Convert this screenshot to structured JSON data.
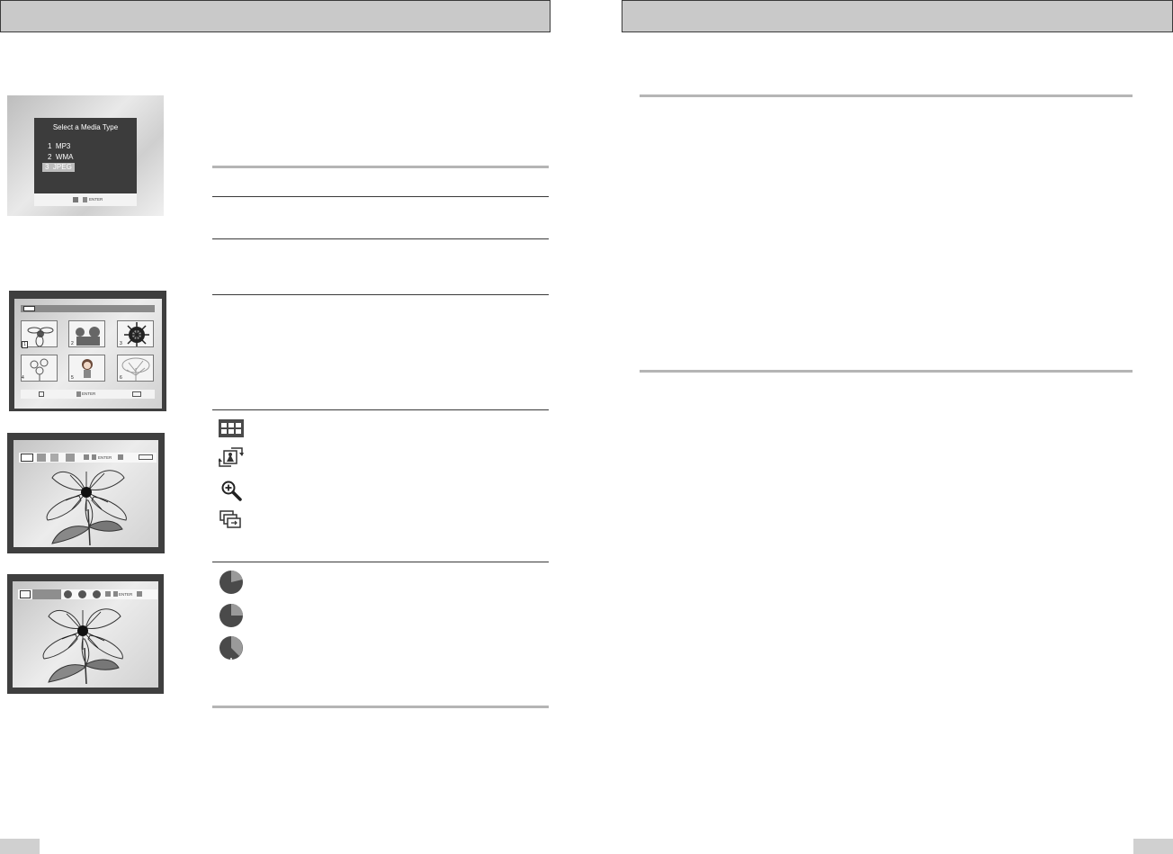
{
  "menu_screen": {
    "title": "Select a Media Type",
    "options": [
      {
        "num": "1",
        "label": "MP3",
        "selected": false
      },
      {
        "num": "2",
        "label": "WMA",
        "selected": false
      },
      {
        "num": "3",
        "label": "JPEG",
        "selected": true
      }
    ],
    "enter_label": "ENTER"
  },
  "thumbnail_screen": {
    "thumb_numbers": [
      "1",
      "2",
      "3",
      "4",
      "5",
      "6"
    ],
    "enter_label": "ENTER"
  },
  "menu_bar_screen": {
    "enter_label": "ENTER"
  },
  "slideshow_screen": {
    "enter_label": "ENTER"
  },
  "icons": [
    "thumbnail-grid-icon",
    "rotate-icon",
    "zoom-icon",
    "slideshow-icon",
    "slow-speed-icon",
    "normal-speed-icon",
    "fast-speed-icon"
  ],
  "colors": {
    "header": "#c9c9c9",
    "screen_dark": "#3f3f3f",
    "icon": "#4a4a4a"
  }
}
